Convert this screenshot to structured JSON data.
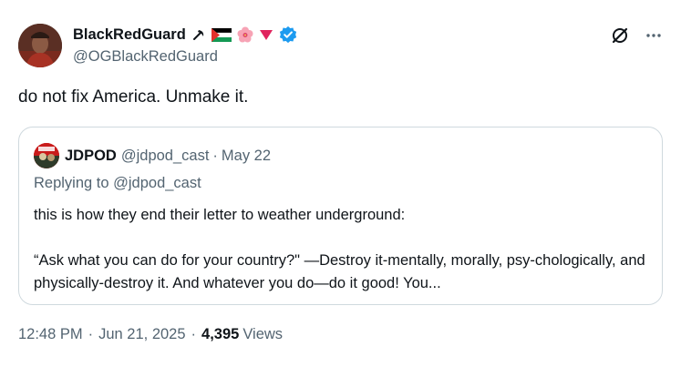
{
  "author": {
    "display_name": "BlackRedGuard",
    "handle": "@OGBlackRedGuard",
    "emojis": [
      "hammer-sickle",
      "palestine-flag",
      "hibiscus",
      "red-triangle"
    ],
    "verified": true
  },
  "tweet": {
    "text": "do not fix America. Unmake it."
  },
  "quote": {
    "display_name": "JDPOD",
    "handle": "@jdpod_cast",
    "separator": "·",
    "date": "May 22",
    "replying_to": "Replying to @jdpod_cast",
    "paragraphs": [
      "this is how they end their letter to weather underground:",
      "“Ask what you can do for your country?\" —Destroy it-mentally, morally, psy-chologically, and physically-destroy it. And whatever you do—do it good! You..."
    ]
  },
  "meta": {
    "time": "12:48 PM",
    "separator": "·",
    "date": "Jun 21, 2025",
    "views_count": "4,395",
    "views_label": "Views"
  },
  "colors": {
    "text": "#0f1419",
    "secondary": "#536471",
    "verified": "#1d9bf0",
    "border": "#cfd9de"
  }
}
